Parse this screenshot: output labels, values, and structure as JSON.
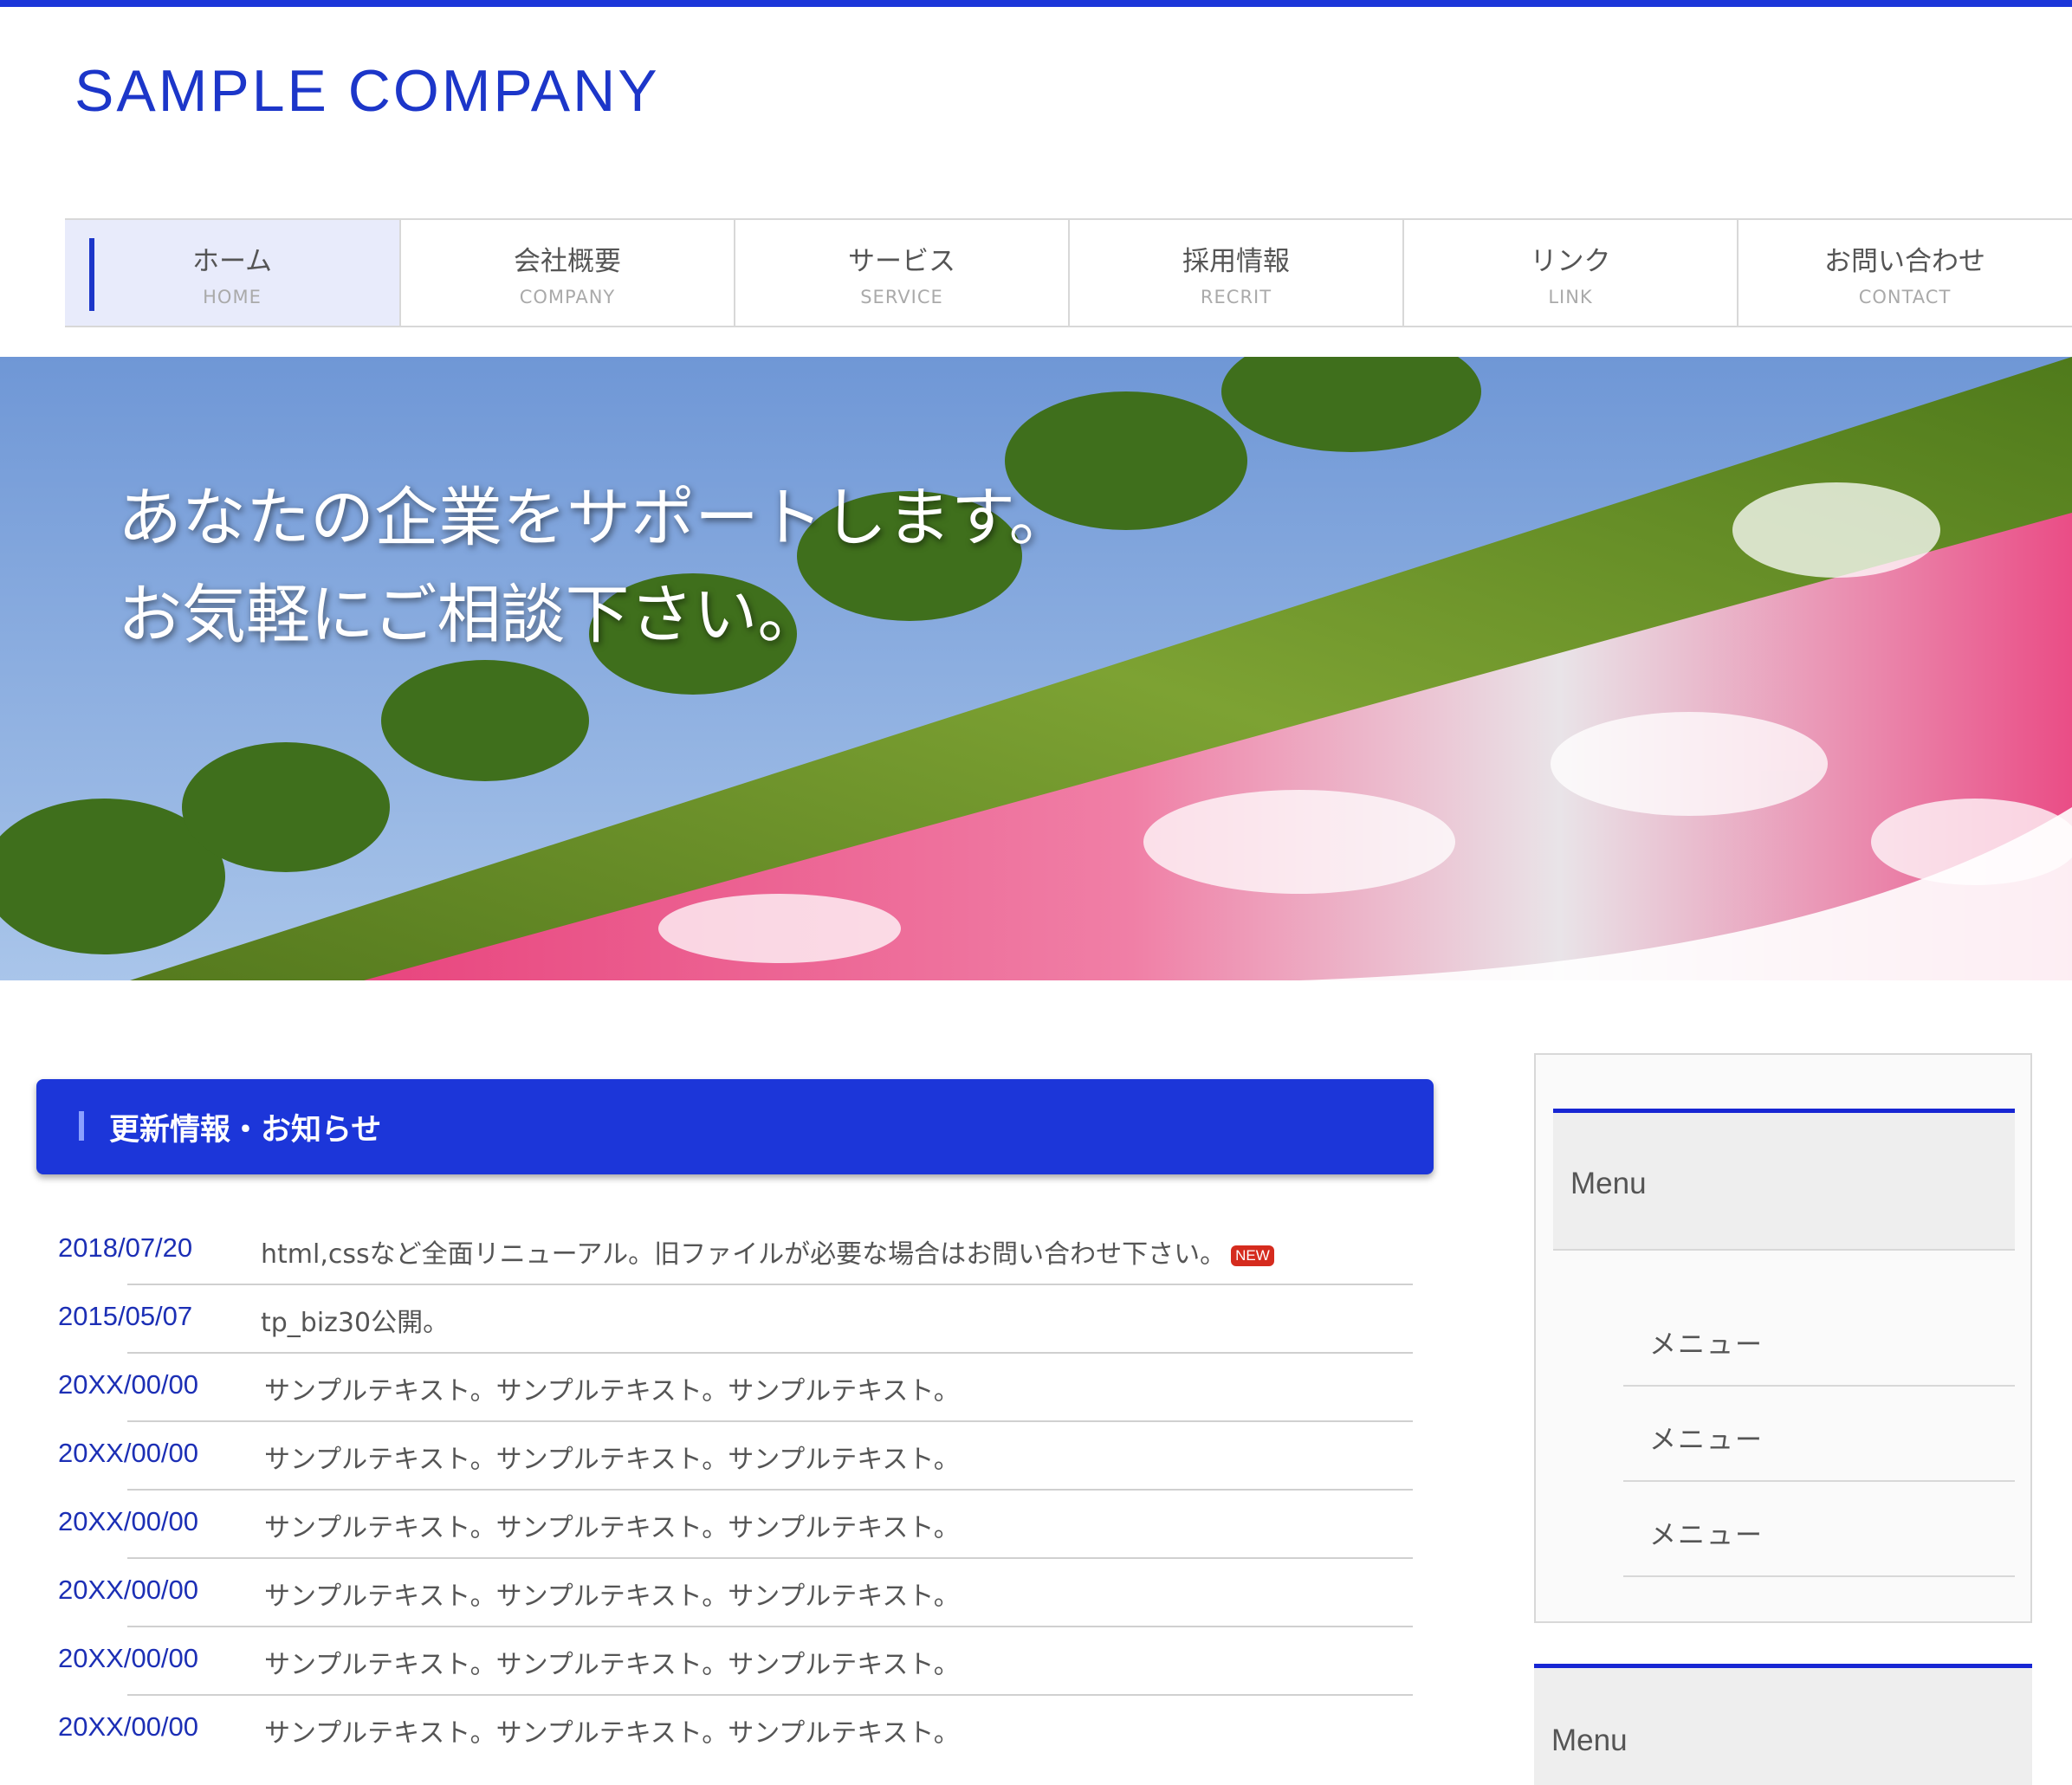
{
  "brand": {
    "logo": "SAMPLE COMPANY",
    "accent": "#1c36d9"
  },
  "nav": [
    {
      "jp": "ホーム",
      "en": "HOME",
      "active": true
    },
    {
      "jp": "会社概要",
      "en": "COMPANY"
    },
    {
      "jp": "サービス",
      "en": "SERVICE"
    },
    {
      "jp": "採用情報",
      "en": "RECRIT"
    },
    {
      "jp": "リンク",
      "en": "LINK"
    },
    {
      "jp": "お問い合わせ",
      "en": "CONTACT"
    }
  ],
  "hero": {
    "line1": "あなたの企業をサポートします。",
    "line2": "お気軽にご相談下さい。"
  },
  "news": {
    "heading": "更新情報・お知らせ",
    "items": [
      {
        "date": "2018/07/20",
        "text": "html,cssなど全面リニューアル。旧ファイルが必要な場合はお問い合わせ下さい。",
        "badge": "NEW"
      },
      {
        "date": "2015/05/07",
        "text": "tp_biz30公開。"
      },
      {
        "date": "20XX/00/00",
        "text": "サンプルテキスト。サンプルテキスト。サンプルテキスト。"
      },
      {
        "date": "20XX/00/00",
        "text": "サンプルテキスト。サンプルテキスト。サンプルテキスト。"
      },
      {
        "date": "20XX/00/00",
        "text": "サンプルテキスト。サンプルテキスト。サンプルテキスト。"
      },
      {
        "date": "20XX/00/00",
        "text": "サンプルテキスト。サンプルテキスト。サンプルテキスト。"
      },
      {
        "date": "20XX/00/00",
        "text": "サンプルテキスト。サンプルテキスト。サンプルテキスト。"
      },
      {
        "date": "20XX/00/00",
        "text": "サンプルテキスト。サンプルテキスト。サンプルテキスト。"
      }
    ]
  },
  "sidebar": {
    "box1": {
      "title": "Menu",
      "items": [
        "メニュー",
        "メニュー",
        "メニュー"
      ]
    },
    "box2": {
      "title": "Menu"
    }
  }
}
